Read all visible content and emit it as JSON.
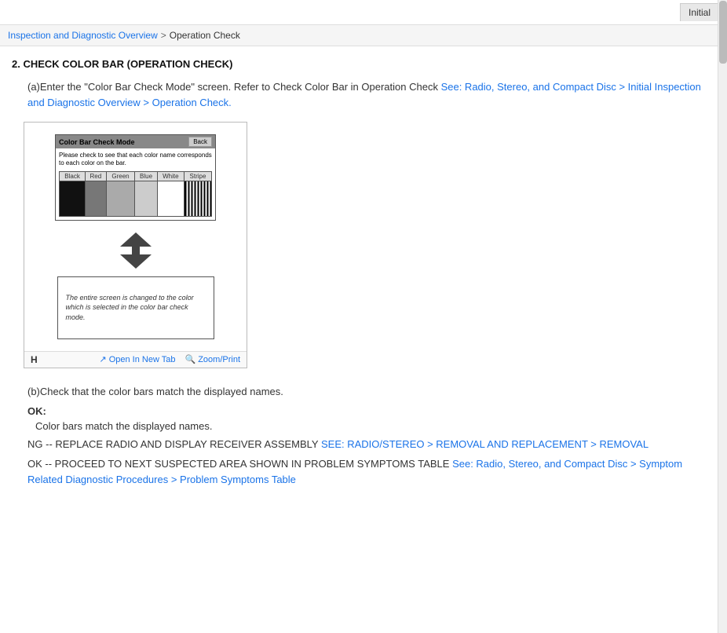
{
  "topbar": {
    "initial_tab": "Initial"
  },
  "breadcrumb": {
    "part1": "Inspection and Diagnostic Overview",
    "separator1": ">",
    "part2": "Operation Check"
  },
  "section": {
    "title": "2. CHECK COLOR BAR (OPERATION CHECK)",
    "intro_prefix": "(a)Enter the \"Color Bar Check Mode\" screen. Refer to Check Color Bar in Operation Check ",
    "intro_link": "See: Radio, Stereo, and Compact Disc > Initial Inspection and Diagnostic Overview > Operation Check.",
    "color_bar_screen": {
      "header": "Color Bar Check Mode",
      "back_button": "Back",
      "instruction": "Please check to see that each color name corresponds to each color on the bar.",
      "columns": [
        "Black",
        "Red",
        "Green",
        "Blue",
        "White",
        "Stripe"
      ]
    },
    "result_text": "The entire screen is changed to the color which is selected in the color bar check mode.",
    "h_label": "H",
    "open_new_tab": "Open In New Tab",
    "zoom_print": "Zoom/Print",
    "check_b_prefix": "(b)",
    "check_b_text": "Check that the color bars match the displayed names.",
    "ok_label": "OK:",
    "ok_result": "Color bars match the displayed names.",
    "ng_text": "NG -- REPLACE RADIO AND DISPLAY RECEIVER ASSEMBLY ",
    "ng_link": "See: Radio/Stereo > Removal and Replacement > Removal",
    "ok2_text": "OK -- PROCEED TO NEXT SUSPECTED AREA SHOWN IN PROBLEM SYMPTOMS TABLE ",
    "ok2_link": "See: Radio, Stereo, and Compact Disc > Symptom Related Diagnostic Procedures > Problem Symptoms Table"
  }
}
